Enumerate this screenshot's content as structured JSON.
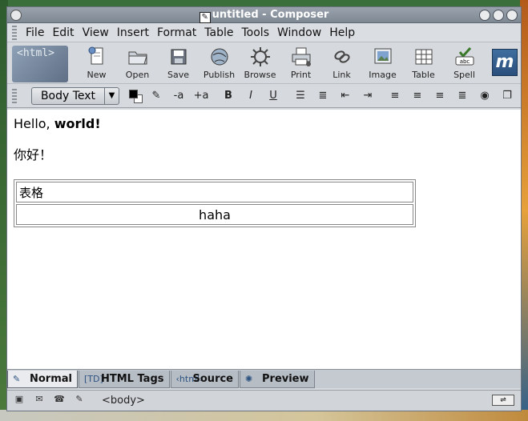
{
  "window": {
    "title": "untitled - Composer"
  },
  "menubar": {
    "items": [
      "File",
      "Edit",
      "View",
      "Insert",
      "Format",
      "Table",
      "Tools",
      "Window",
      "Help"
    ]
  },
  "toolbar": {
    "buttons": [
      {
        "label": "New",
        "icon": "new-page-icon"
      },
      {
        "label": "Open",
        "icon": "folder-open-icon"
      },
      {
        "label": "Save",
        "icon": "save-disk-icon"
      },
      {
        "label": "Publish",
        "icon": "globe-publish-icon"
      },
      {
        "label": "Browse",
        "icon": "browse-icon"
      },
      {
        "label": "Print",
        "icon": "printer-icon"
      },
      {
        "label": "Link",
        "icon": "link-icon"
      },
      {
        "label": "Image",
        "icon": "image-icon"
      },
      {
        "label": "Table",
        "icon": "table-icon"
      },
      {
        "label": "Spell",
        "icon": "spell-check-icon"
      }
    ],
    "logo_text": "<html>"
  },
  "format": {
    "paragraph_style": "Body Text",
    "text_color": "#000000",
    "background_color": "#ffffff"
  },
  "document": {
    "greeting_plain": "Hello, ",
    "greeting_bold": "world!",
    "chinese_line": "你好！",
    "table": {
      "cell_1": "表格",
      "cell_2": "haha"
    }
  },
  "tabs": [
    "Normal",
    "HTML Tags",
    "Source",
    "Preview"
  ],
  "status": {
    "path": "<body>"
  }
}
